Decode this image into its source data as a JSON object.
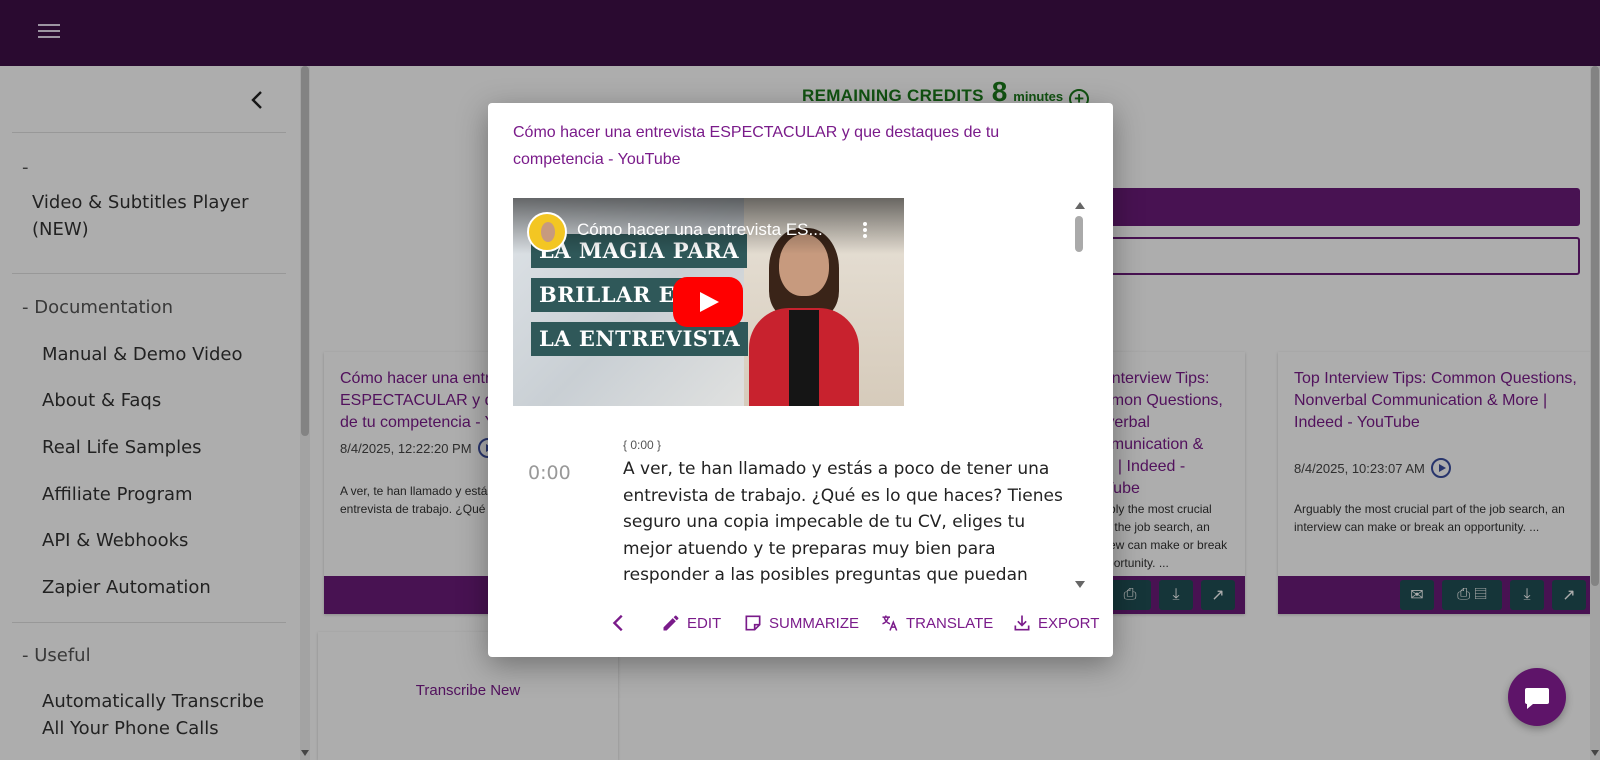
{
  "sidebar": {
    "dash": "-",
    "player_item": "Video & Subtitles Player (NEW)",
    "documentation_heading": "- Documentation",
    "documentation_items": [
      "Manual & Demo Video",
      "About & Faqs",
      "Real Life Samples",
      "Affiliate Program",
      "API & Webhooks",
      "Zapier Automation"
    ],
    "useful_heading": "- Useful",
    "useful_items": [
      "Automatically Transcribe All Your Phone Calls"
    ]
  },
  "credits": {
    "label": "REMAINING CREDITS",
    "value": "8",
    "unit": "minutes"
  },
  "cards": [
    {
      "title": "Cómo hacer una entrevista ESPECTACULAR y que destaques de tu competencia - YouTube",
      "date": "8/4/2025, 12:22:20 PM",
      "snippet": "A ver, te han llamado y estás a poco de tener una entrevista de trabajo. ¿Qué es lo que haces? Ti..."
    },
    {
      "title": "Top Interview Tips: Common Questions, Nonverbal Communication & More | Indeed - YouTube",
      "date": "",
      "snippet": "Arguably the most crucial part of the job search, an interview can make or break an opportunity. ..."
    },
    {
      "title": "Top Interview Tips: Common Questions, Nonverbal Communication & More | Indeed - YouTube",
      "date": "8/4/2025, 10:23:07 AM",
      "snippet": "Arguably the most crucial part of the job search, an interview can make or break an opportunity. ..."
    }
  ],
  "transcribe_new": "Transcribe New",
  "modal": {
    "title": "Cómo hacer una entrevista ESPECTACULAR y que destaques de tu competencia - YouTube",
    "video": {
      "title": "Cómo hacer una entrevista ES...",
      "overlay_lines": [
        "LA MAGIA PARA",
        "BRILLAR EN",
        "LA ENTREVISTA"
      ]
    },
    "segment": {
      "marker": "{ 0:00 }",
      "time": "0:00",
      "text": "A ver, te han llamado y estás a poco de tener una entrevista de trabajo. ¿Qué es lo que haces? Tienes seguro una copia impecable de tu CV, eliges tu mejor atuendo y te preparas muy bien para responder a las posibles preguntas que puedan"
    },
    "actions": {
      "edit": "EDIT",
      "summarize": "SUMMARIZE",
      "translate": "TRANSLATE",
      "export": "EXPORT"
    }
  },
  "colors": {
    "topbar": "#3f0f48",
    "accent": "#7a1b8a",
    "action_bar": "#6a1b7a",
    "credits": "#1a7a1a",
    "icon_button": "#1f4f54"
  },
  "icons": [
    "menu-icon",
    "chevron-left-icon",
    "plus-circle-icon",
    "play-circle-icon",
    "mail-icon",
    "print-icon",
    "pdf-icon",
    "download-icon",
    "open-external-icon",
    "edit-icon",
    "summarize-icon",
    "translate-icon",
    "export-icon",
    "chat-icon"
  ]
}
